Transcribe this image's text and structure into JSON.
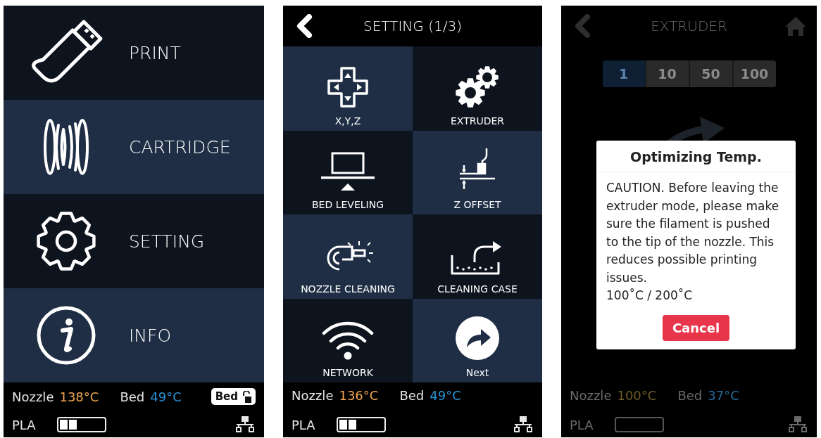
{
  "screens": [
    {
      "kind": "main_menu",
      "menu": [
        {
          "kind": "print",
          "label": "PRINT"
        },
        {
          "kind": "cartridge",
          "label": "CARTRIDGE"
        },
        {
          "kind": "setting",
          "label": "SETTING"
        },
        {
          "kind": "info",
          "label": "INFO"
        }
      ],
      "footer": {
        "nozzle_label": "Nozzle",
        "nozzle_temp": "138°C",
        "bed_label": "Bed",
        "bed_temp": "49°C",
        "filament": "PLA",
        "level": 0.4,
        "bed_lock": {
          "label": "Bed",
          "locked": false
        }
      }
    },
    {
      "kind": "settings",
      "title": "SETTING (1/3)",
      "tiles": [
        {
          "kind": "xyz",
          "label": "X,Y,Z"
        },
        {
          "kind": "extruder",
          "label": "EXTRUDER"
        },
        {
          "kind": "bed_leveling",
          "label": "BED LEVELING"
        },
        {
          "kind": "z_offset",
          "label": "Z OFFSET"
        },
        {
          "kind": "nozzle_cleaning",
          "label": "NOZZLE CLEANING"
        },
        {
          "kind": "cleaning_case",
          "label": "CLEANING CASE"
        },
        {
          "kind": "network",
          "label": "NETWORK"
        },
        {
          "kind": "next",
          "label": "Next"
        }
      ],
      "footer": {
        "nozzle_label": "Nozzle",
        "nozzle_temp": "136°C",
        "bed_label": "Bed",
        "bed_temp": "49°C",
        "filament": "PLA",
        "level": 0.4
      }
    },
    {
      "kind": "extruder",
      "title": "EXTRUDER",
      "steps": [
        {
          "label": "1",
          "selected": true
        },
        {
          "label": "10",
          "selected": false
        },
        {
          "label": "50",
          "selected": false
        },
        {
          "label": "100",
          "selected": false
        }
      ],
      "dialog": {
        "title": "Optimizing Temp.",
        "body": "CAUTION. Before leaving the extruder mode, please make sure the filament is pushed to the tip of the nozzle. This reduces possible printing issues.",
        "temps": "100˚C / 200˚C",
        "button": "Cancel"
      },
      "footer": {
        "nozzle_label": "Nozzle",
        "nozzle_temp": "100°C",
        "bed_label": "Bed",
        "bed_temp": "37°C",
        "filament": "PLA",
        "level": 0
      }
    }
  ]
}
